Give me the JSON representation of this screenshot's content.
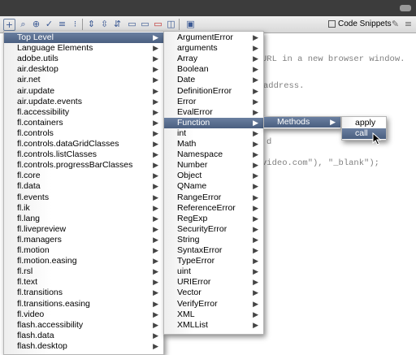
{
  "toolbar": {
    "code_snippets_label": "Code Snippets"
  },
  "code_lines": [
    {
      "text": "URL in a new browser window."
    },
    {
      "text": "address."
    },
    {
      "text": "d"
    },
    {
      "text": "video.com\"), \"_blank\");"
    }
  ],
  "menu1": {
    "items": [
      {
        "label": "Top Level",
        "selected": true
      },
      {
        "label": "Language Elements"
      },
      {
        "label": "adobe.utils"
      },
      {
        "label": "air.desktop"
      },
      {
        "label": "air.net"
      },
      {
        "label": "air.update"
      },
      {
        "label": "air.update.events"
      },
      {
        "label": "fl.accessibility"
      },
      {
        "label": "fl.containers"
      },
      {
        "label": "fl.controls"
      },
      {
        "label": "fl.controls.dataGridClasses"
      },
      {
        "label": "fl.controls.listClasses"
      },
      {
        "label": "fl.controls.progressBarClasses"
      },
      {
        "label": "fl.core"
      },
      {
        "label": "fl.data"
      },
      {
        "label": "fl.events"
      },
      {
        "label": "fl.ik"
      },
      {
        "label": "fl.lang"
      },
      {
        "label": "fl.livepreview"
      },
      {
        "label": "fl.managers"
      },
      {
        "label": "fl.motion"
      },
      {
        "label": "fl.motion.easing"
      },
      {
        "label": "fl.rsl"
      },
      {
        "label": "fl.text"
      },
      {
        "label": "fl.transitions"
      },
      {
        "label": "fl.transitions.easing"
      },
      {
        "label": "fl.video"
      },
      {
        "label": "flash.accessibility"
      },
      {
        "label": "flash.data"
      },
      {
        "label": "flash.desktop"
      }
    ]
  },
  "menu2": {
    "items": [
      {
        "label": "ArgumentError"
      },
      {
        "label": "arguments"
      },
      {
        "label": "Array"
      },
      {
        "label": "Boolean"
      },
      {
        "label": "Date"
      },
      {
        "label": "DefinitionError"
      },
      {
        "label": "Error"
      },
      {
        "label": "EvalError"
      },
      {
        "label": "Function",
        "selected": true
      },
      {
        "label": "int"
      },
      {
        "label": "Math"
      },
      {
        "label": "Namespace"
      },
      {
        "label": "Number"
      },
      {
        "label": "Object"
      },
      {
        "label": "QName"
      },
      {
        "label": "RangeError"
      },
      {
        "label": "ReferenceError"
      },
      {
        "label": "RegExp"
      },
      {
        "label": "SecurityError"
      },
      {
        "label": "String"
      },
      {
        "label": "SyntaxError"
      },
      {
        "label": "TypeError"
      },
      {
        "label": "uint"
      },
      {
        "label": "URIError"
      },
      {
        "label": "Vector"
      },
      {
        "label": "VerifyError"
      },
      {
        "label": "XML"
      },
      {
        "label": "XMLList"
      }
    ]
  },
  "menu3": {
    "items": [
      {
        "label": "Methods",
        "selected": true
      }
    ]
  },
  "menu4": {
    "items": [
      {
        "label": "apply"
      },
      {
        "label": "call",
        "selected": true
      }
    ]
  },
  "submenu_arrow": "▶"
}
